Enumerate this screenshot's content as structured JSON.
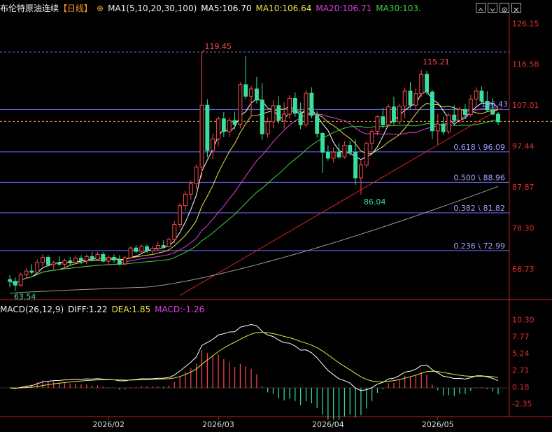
{
  "header": {
    "instrument": "布伦特原油连续",
    "period": "【日线】",
    "ma_label": "MA1(5,10,20,30,100)",
    "ma5": "MA5:106.70",
    "ma10": "MA10:106.64",
    "ma20": "MA20:106.71",
    "ma30": "MA30:103.",
    "icons": [
      "target-icon",
      "chevron-up-icon",
      "chevron-down-icon",
      "gear-icon",
      "close-icon"
    ]
  },
  "macd_header": {
    "label": "MACD(26,12,9)",
    "diff": "DIFF:1.22",
    "dea": "DEA:1.85",
    "macd": "MACD:-1.26"
  },
  "colors": {
    "up": "#ff4a4a",
    "down": "#38e0a0",
    "ma5": "#ffffff",
    "ma10": "#e6e64a",
    "ma20": "#e040e0",
    "ma30": "#40d040",
    "ma100": "#9a9a9a",
    "fib": "#7070ff",
    "trend": "#e02020",
    "diff": "#ffffff",
    "dea": "#e6e64a"
  },
  "chart_data": [
    {
      "type": "candlestick",
      "title": "布伦特原油连续【日线】",
      "ylim": [
        62,
        128
      ],
      "y_ticks": [
        "126.15",
        "116.58",
        "107.01",
        "97.44",
        "87.87",
        "78.30",
        "68.73"
      ],
      "x_ticks": [
        "2026/02",
        "2026/03",
        "2026/04",
        "2026/05"
      ],
      "annotations": {
        "high": "119.45",
        "peak2": "115.21",
        "low": "86.04",
        "start_low": "63.54",
        "last_ma": "106.43"
      },
      "fib_levels": [
        {
          "label": "0.618 \\ 96.09",
          "value": 96.09
        },
        {
          "label": "0.500 \\ 88.96",
          "value": 88.96
        },
        {
          "label": "0.382 \\ 81.82",
          "value": 81.82
        },
        {
          "label": "0.236 \\ 72.99",
          "value": 72.99
        }
      ],
      "hlines": [
        119.45,
        106.0,
        103.2
      ],
      "ohlc": [
        [
          66.2,
          67.2,
          64.4,
          65.8
        ],
        [
          65.8,
          66.7,
          63.54,
          64.9
        ],
        [
          64.9,
          67.8,
          64.6,
          67.3
        ],
        [
          67.3,
          68.9,
          66.6,
          68.2
        ],
        [
          68.2,
          69.8,
          67.4,
          67.9
        ],
        [
          67.9,
          70.9,
          67.6,
          70.2
        ],
        [
          70.2,
          72.1,
          69.3,
          71.4
        ],
        [
          71.4,
          71.9,
          69.2,
          69.7
        ],
        [
          69.7,
          70.6,
          68.6,
          70.1
        ],
        [
          70.1,
          71.7,
          69.4,
          69.8
        ],
        [
          69.8,
          71.1,
          68.8,
          70.6
        ],
        [
          70.6,
          71.5,
          69.6,
          70.3
        ],
        [
          70.3,
          71.9,
          69.8,
          71.2
        ],
        [
          71.2,
          71.9,
          69.9,
          70.6
        ],
        [
          70.6,
          72.1,
          69.8,
          71.6
        ],
        [
          71.6,
          72.6,
          70.4,
          70.9
        ],
        [
          70.9,
          72.6,
          70.7,
          72.1
        ],
        [
          72.1,
          72.6,
          70.3,
          70.5
        ],
        [
          70.5,
          71.9,
          69.9,
          71.4
        ],
        [
          71.4,
          72.1,
          70.1,
          70.8
        ],
        [
          70.8,
          71.9,
          69.5,
          69.9
        ],
        [
          69.9,
          71.8,
          69.4,
          71.3
        ],
        [
          71.3,
          73.9,
          71.0,
          73.6
        ],
        [
          73.6,
          74.3,
          72.4,
          72.8
        ],
        [
          72.8,
          74.4,
          72.3,
          73.9
        ],
        [
          73.9,
          74.4,
          72.4,
          72.9
        ],
        [
          72.9,
          74.1,
          72.0,
          73.5
        ],
        [
          73.5,
          75.1,
          73.0,
          74.2
        ],
        [
          74.2,
          75.4,
          73.4,
          73.9
        ],
        [
          73.9,
          76.0,
          73.7,
          75.6
        ],
        [
          75.6,
          79.9,
          74.8,
          79.1
        ],
        [
          79.1,
          84.1,
          78.4,
          83.5
        ],
        [
          83.5,
          86.9,
          82.3,
          86.2
        ],
        [
          86.2,
          89.4,
          84.9,
          88.6
        ],
        [
          88.6,
          93.1,
          87.4,
          92.5
        ],
        [
          92.5,
          119.45,
          90.1,
          107.0
        ],
        [
          107.0,
          108.4,
          94.8,
          96.4
        ],
        [
          96.4,
          100.4,
          94.4,
          99.1
        ],
        [
          99.1,
          104.4,
          97.4,
          103.8
        ],
        [
          103.8,
          105.4,
          99.5,
          100.8
        ],
        [
          100.8,
          104.1,
          99.6,
          103.4
        ],
        [
          103.4,
          105.5,
          101.3,
          102.5
        ],
        [
          102.5,
          112.4,
          101.6,
          111.8
        ],
        [
          111.8,
          118.5,
          108.4,
          109.1
        ],
        [
          109.1,
          111.5,
          104.3,
          110.8
        ],
        [
          110.8,
          113.6,
          107.4,
          108.2
        ],
        [
          108.2,
          112.2,
          98.9,
          100.3
        ],
        [
          100.3,
          104.1,
          99.4,
          103.1
        ],
        [
          103.1,
          108.2,
          101.6,
          106.9
        ],
        [
          106.9,
          109.1,
          102.7,
          103.4
        ],
        [
          103.4,
          107.6,
          101.5,
          104.9
        ],
        [
          104.9,
          109.3,
          103.8,
          108.6
        ],
        [
          108.6,
          110.0,
          104.3,
          105.1
        ],
        [
          105.1,
          107.6,
          101.4,
          102.4
        ],
        [
          102.4,
          110.5,
          101.8,
          109.8
        ],
        [
          109.8,
          111.2,
          103.9,
          104.6
        ],
        [
          104.6,
          105.6,
          99.4,
          100.4
        ],
        [
          100.4,
          100.8,
          91.2,
          96.0
        ],
        [
          96.0,
          97.6,
          94.0,
          94.6
        ],
        [
          94.6,
          97.1,
          93.6,
          96.0
        ],
        [
          96.0,
          98.1,
          94.4,
          94.9
        ],
        [
          94.9,
          98.6,
          94.5,
          97.6
        ],
        [
          97.6,
          98.6,
          95.2,
          96.0
        ],
        [
          96.0,
          99.1,
          88.4,
          90.0
        ],
        [
          90.0,
          94.1,
          86.04,
          93.0
        ],
        [
          93.0,
          98.6,
          92.4,
          98.1
        ],
        [
          98.1,
          101.4,
          96.4,
          100.9
        ],
        [
          100.9,
          104.6,
          100.0,
          104.3
        ],
        [
          104.3,
          106.4,
          101.6,
          102.4
        ],
        [
          102.4,
          107.2,
          102.0,
          106.6
        ],
        [
          106.6,
          109.0,
          102.4,
          103.1
        ],
        [
          103.1,
          107.3,
          102.6,
          106.8
        ],
        [
          106.8,
          111.1,
          103.9,
          110.3
        ],
        [
          110.3,
          112.4,
          106.2,
          107.0
        ],
        [
          107.0,
          110.9,
          105.8,
          109.7
        ],
        [
          109.7,
          115.21,
          109.0,
          114.2
        ],
        [
          114.2,
          115.0,
          109.4,
          110.1
        ],
        [
          110.1,
          110.6,
          99.1,
          101.0
        ],
        [
          101.0,
          104.9,
          97.8,
          102.6
        ],
        [
          102.6,
          104.3,
          100.1,
          100.8
        ],
        [
          100.8,
          105.1,
          100.3,
          104.7
        ],
        [
          104.7,
          107.0,
          102.9,
          103.5
        ],
        [
          103.5,
          106.6,
          102.8,
          106.0
        ],
        [
          106.0,
          107.2,
          104.1,
          104.8
        ],
        [
          104.8,
          109.4,
          104.3,
          108.4
        ],
        [
          108.4,
          111.2,
          106.4,
          110.3
        ],
        [
          110.3,
          111.4,
          107.2,
          107.9
        ],
        [
          107.9,
          110.3,
          105.4,
          105.9
        ],
        [
          105.9,
          108.6,
          104.6,
          104.9
        ],
        [
          104.9,
          105.4,
          102.3,
          103.1
        ]
      ]
    },
    {
      "type": "macd",
      "title": "MACD(26,12,9)",
      "ylim": [
        -3.8,
        11.2
      ],
      "y_ticks": [
        "10.30",
        "7.77",
        "5.24",
        "2.71",
        "0.18",
        "-2.35"
      ]
    }
  ]
}
